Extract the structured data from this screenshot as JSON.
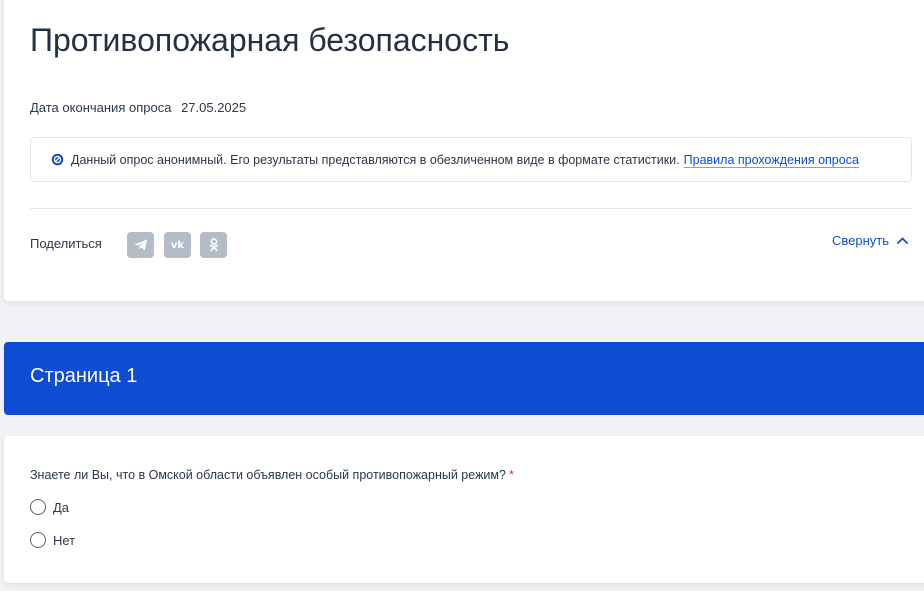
{
  "survey": {
    "title": "Противопожарная безопасность",
    "deadline_label": "Дата окончания опроса",
    "deadline_value": "27.05.2025",
    "notice_text": "Данный опрос анонимный. Его результаты представляются в обезличенном виде в формате статистики.",
    "rules_link": "Правила прохождения опроса"
  },
  "share": {
    "label": "Поделиться",
    "networks": [
      "telegram-icon",
      "vk-icon",
      "odnoklassniki-icon"
    ],
    "vk_text": "vk"
  },
  "collapse": {
    "label": "Свернуть"
  },
  "page": {
    "title": "Страница 1"
  },
  "question": {
    "text": "Знаете ли Вы, что в Омской области объявлен особый противопожарный режим?",
    "required_mark": "*",
    "options": [
      "Да",
      "Нет"
    ]
  },
  "colors": {
    "accent": "#0d4cd3",
    "share_icon_bg": "#b4bcc8",
    "required": "#e0303a",
    "page_bg": "#f0f2f5"
  }
}
